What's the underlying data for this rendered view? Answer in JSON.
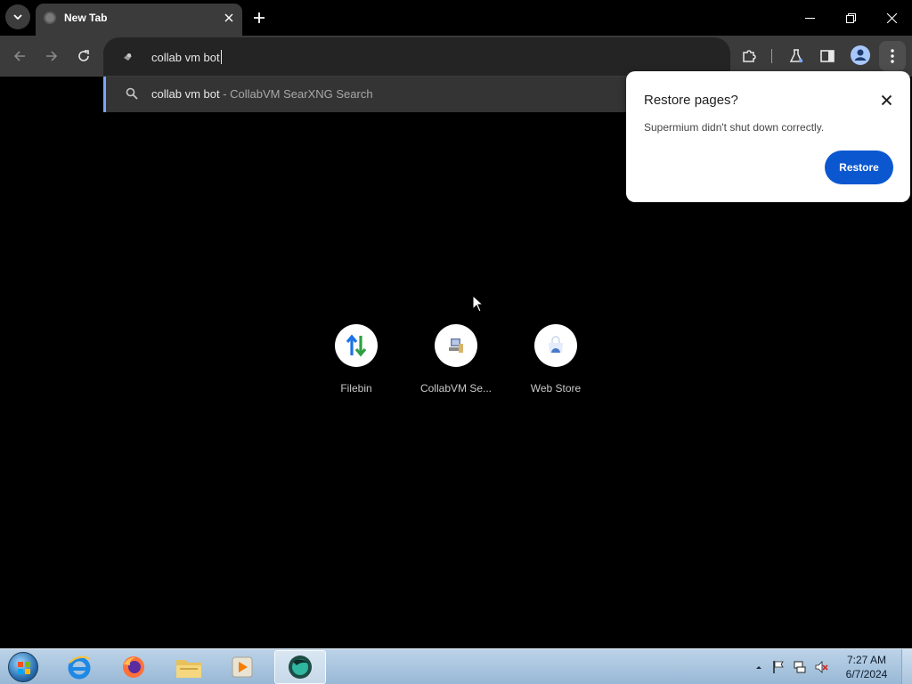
{
  "browser": {
    "tab": {
      "title": "New Tab"
    },
    "omnibox": {
      "value": "collab vm bot"
    },
    "suggestion": {
      "query": "collab vm bot",
      "separator": " - ",
      "engine": "CollabVM SearXNG Search"
    }
  },
  "popup": {
    "title": "Restore pages?",
    "message": "Supermium didn't shut down correctly.",
    "restore_label": "Restore"
  },
  "shortcuts": [
    {
      "label": "Filebin"
    },
    {
      "label": "CollabVM Se..."
    },
    {
      "label": "Web Store"
    }
  ],
  "taskbar": {
    "time": "7:27 AM",
    "date": "6/7/2024"
  },
  "colors": {
    "accent_blue": "#0b57d0",
    "toolbar": "#3b3b3b",
    "background": "#000000"
  }
}
